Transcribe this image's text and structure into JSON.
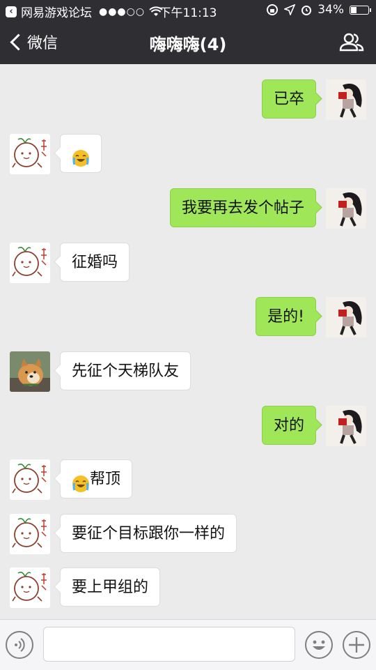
{
  "status_bar": {
    "back_app": "网易游戏论坛",
    "signal": "●●●○○",
    "time": "下午11:13",
    "battery_text": "34%",
    "battery_level": 0.34
  },
  "nav": {
    "back_label": "微信",
    "title": "嗨嗨嗨(4)"
  },
  "messages": [
    {
      "side": "right",
      "avatar": "girl-avatar",
      "text": "已卒"
    },
    {
      "side": "left",
      "avatar": "doodle-avatar",
      "text": "",
      "emoji": "laughing-crying-emoji"
    },
    {
      "side": "right",
      "avatar": "girl-avatar",
      "text": "我要再去发个帖子"
    },
    {
      "side": "left",
      "avatar": "doodle-avatar",
      "text": "征婚吗"
    },
    {
      "side": "right",
      "avatar": "girl-avatar",
      "text": "是的!"
    },
    {
      "side": "left",
      "avatar": "dog-avatar",
      "text": "先征个天梯队友"
    },
    {
      "side": "right",
      "avatar": "girl-avatar",
      "text": "对的"
    },
    {
      "side": "left",
      "avatar": "doodle-avatar",
      "text": "帮顶",
      "emoji": "laughing-crying-emoji"
    },
    {
      "side": "left",
      "avatar": "doodle-avatar",
      "text": "要征个目标跟你一样的"
    },
    {
      "side": "left",
      "avatar": "doodle-avatar",
      "text": "要上甲组的"
    }
  ],
  "input": {
    "value": "",
    "placeholder": ""
  },
  "colors": {
    "header_bg": "#2f2f33",
    "chat_bg": "#ebebeb",
    "sent_bubble": "#9fe658",
    "received_bubble": "#ffffff"
  }
}
